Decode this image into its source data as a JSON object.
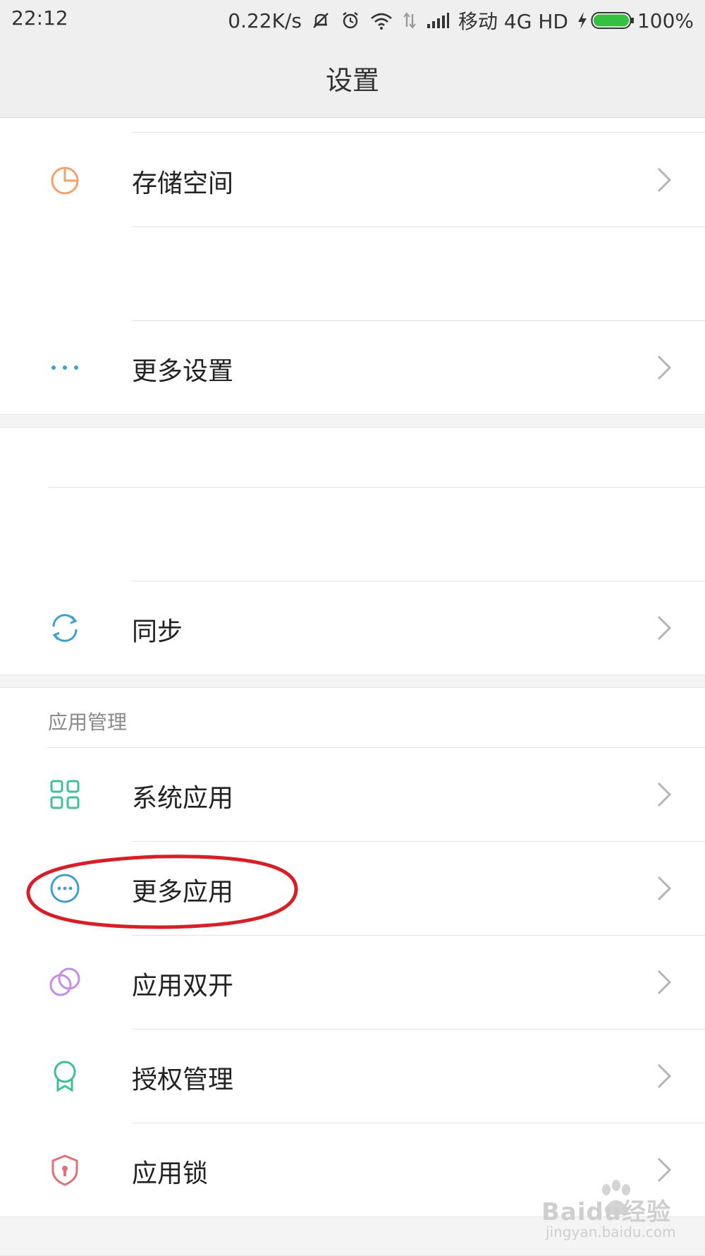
{
  "status_bar": {
    "time": "22:12",
    "speed": "0.22K/s",
    "carrier": "移动 4G HD",
    "battery": "100%"
  },
  "header": {
    "title": "设置"
  },
  "items": {
    "storage": {
      "label": "存储空间",
      "icon": "pie-chart-icon",
      "color": "#f4a06c"
    },
    "more_settings": {
      "label": "更多设置",
      "icon": "dots-icon",
      "color": "#3d9fd6"
    },
    "sync": {
      "label": "同步",
      "icon": "sync-icon",
      "color": "#3d9fd6"
    }
  },
  "app_management": {
    "section_title": "应用管理",
    "items": [
      {
        "label": "系统应用",
        "icon": "grid-icon",
        "color": "#3fbf9a"
      },
      {
        "label": "更多应用",
        "icon": "more-circle-icon",
        "color": "#3d9fd6"
      },
      {
        "label": "应用双开",
        "icon": "dual-circle-icon",
        "color": "#c48ee6"
      },
      {
        "label": "授权管理",
        "icon": "badge-icon",
        "color": "#3fbf9a"
      },
      {
        "label": "应用锁",
        "icon": "shield-lock-icon",
        "color": "#e0707a"
      }
    ]
  },
  "annotation_color": "#d61f26",
  "watermark": {
    "brand": "Baidu经验",
    "url": "jingyan.baidu.com"
  }
}
